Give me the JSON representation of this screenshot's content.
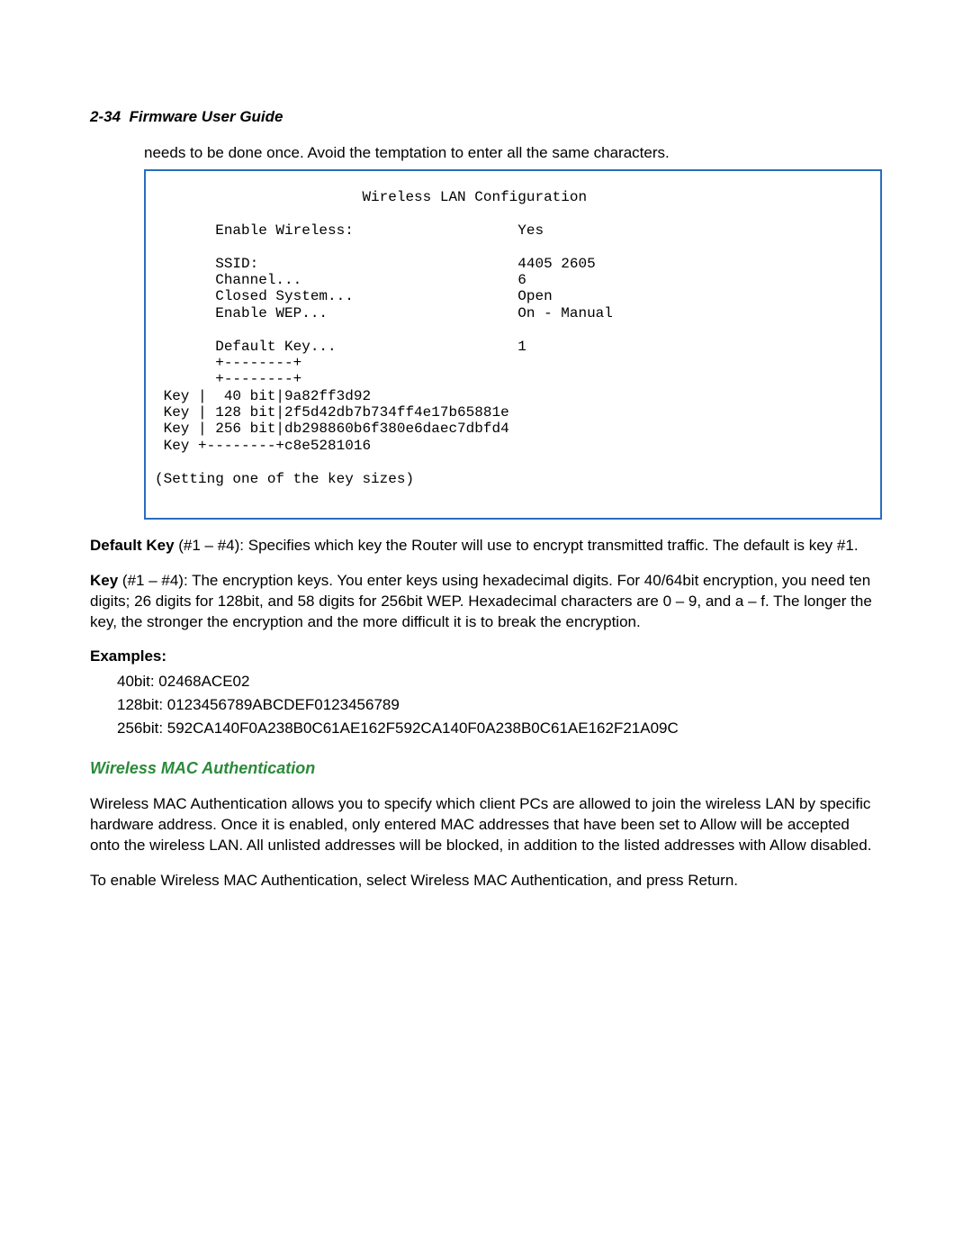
{
  "header": {
    "page_number": "2-34",
    "title": "Firmware User Guide"
  },
  "intro_line": "needs to be done once. Avoid the temptation to enter all the same characters.",
  "config_box": {
    "title": "Wireless LAN Configuration",
    "fields": {
      "enable_wireless_label": "Enable Wireless:",
      "enable_wireless_value": "Yes",
      "ssid_label": "SSID:",
      "ssid_value": "4405 2605",
      "channel_label": "Channel...",
      "channel_value": "6",
      "closed_system_label": "Closed System...",
      "closed_system_value": "Open",
      "enable_wep_label": "Enable WEP...",
      "enable_wep_value": "On - Manual",
      "default_key_label": "Default Key...",
      "default_key_value": "1"
    },
    "key_rows": [
      {
        "label": "Key",
        "bits": " 40 bit",
        "value": "9a82ff3d92"
      },
      {
        "label": "Key",
        "bits": "128 bit",
        "value": "2f5d42db7b734ff4e17b65881e"
      },
      {
        "label": "Key",
        "bits": "256 bit",
        "value": "db298860b6f380e6daec7dbfd4"
      }
    ],
    "last_key_row": {
      "label": "Key",
      "value": "c8e5281016"
    },
    "footer": "(Setting one of the key sizes)"
  },
  "paragraphs": {
    "default_key_bold": "Default Key",
    "default_key_text": " (#1 – #4): Specifies which key the Router will use to encrypt transmitted traffic. The default is key #1.",
    "key_bold": "Key",
    "key_text": " (#1 – #4): The encryption keys. You enter keys using hexadecimal digits. For 40/64bit encryption, you need ten digits; 26 digits for 128bit, and 58 digits for 256bit WEP. Hexadecimal characters are 0 – 9, and a – f. The longer the key, the stronger the encryption and the more difficult it is to break the encryption."
  },
  "examples": {
    "heading": "Examples:",
    "items": [
      "40bit: 02468ACE02",
      "128bit: 0123456789ABCDEF0123456789",
      "256bit: 592CA140F0A238B0C61AE162F592CA140F0A238B0C61AE162F21A09C"
    ]
  },
  "wireless_mac": {
    "heading": "Wireless MAC Authentication",
    "p1": "Wireless MAC Authentication allows you to specify which client PCs are allowed to join the wireless LAN by specific hardware address. Once it is enabled, only entered MAC addresses that have been set to Allow will be accepted onto the wireless LAN. All unlisted addresses will be blocked, in addition to the listed addresses with Allow disabled.",
    "p2": "To enable Wireless MAC Authentication, select Wireless MAC Authentication, and press Return."
  }
}
